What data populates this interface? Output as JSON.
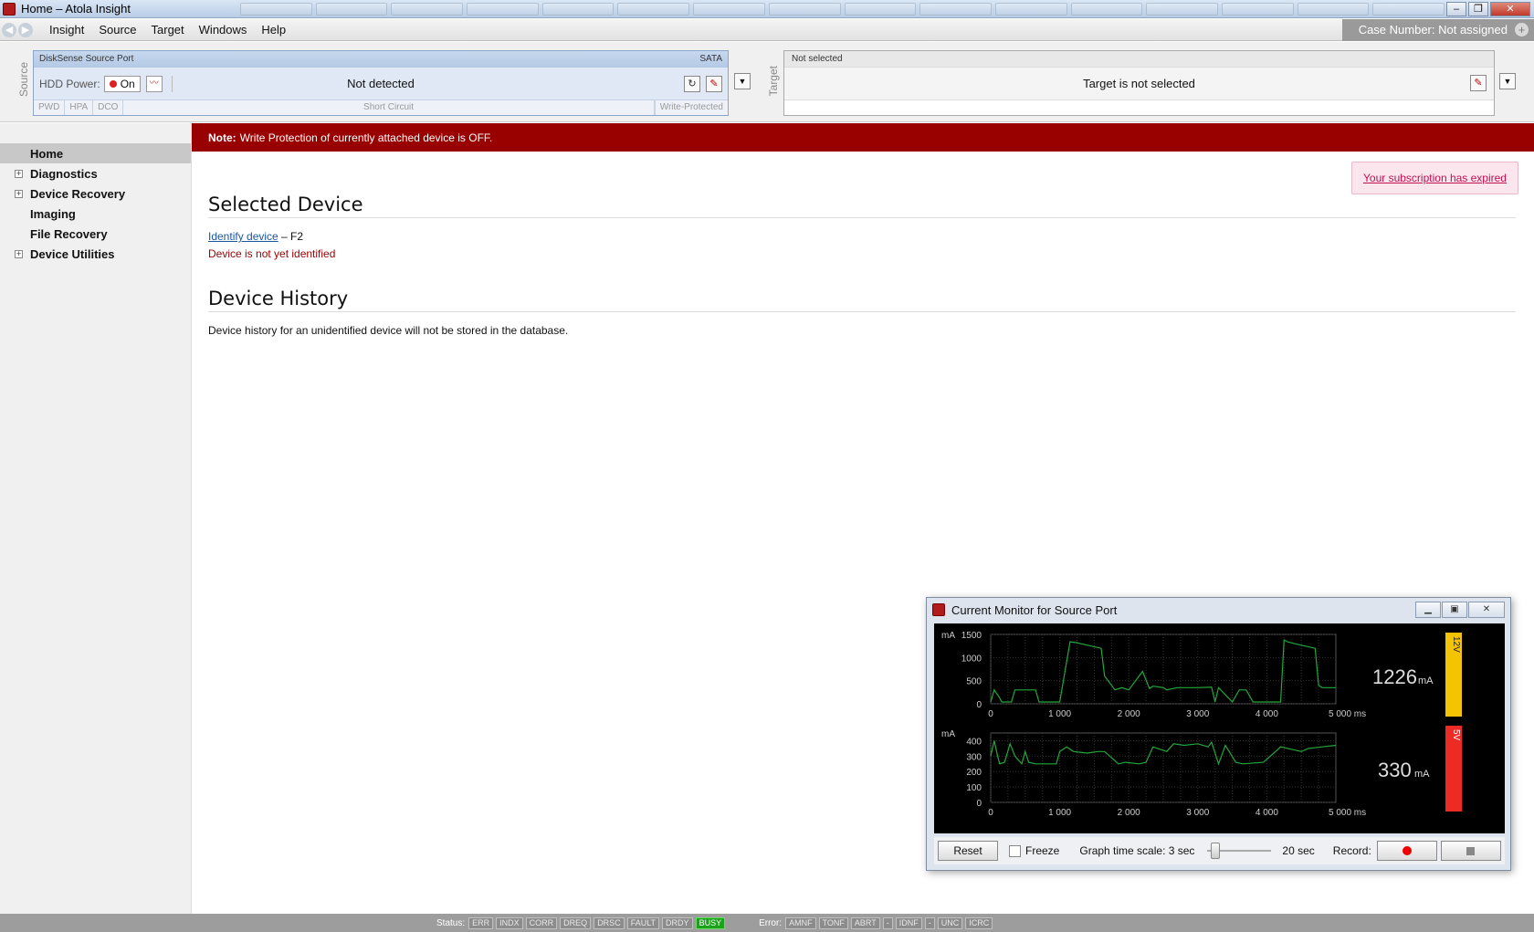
{
  "window": {
    "title": "Home – Atola Insight"
  },
  "menu": {
    "items": [
      "Insight",
      "Source",
      "Target",
      "Windows",
      "Help"
    ],
    "case_number": "Case Number: Not assigned"
  },
  "source": {
    "side_label": "Source",
    "port_name": "DiskSense Source Port",
    "interface": "SATA",
    "hdd_power_label": "HDD Power:",
    "power_state": "On",
    "status": "Not detected",
    "footer_flags": [
      "PWD",
      "HPA",
      "DCO"
    ],
    "short_circuit": "Short Circuit",
    "write_protected": "Write-Protected"
  },
  "target": {
    "side_label": "Target",
    "header": "Not selected",
    "status": "Target is not selected"
  },
  "sidebar": {
    "items": [
      {
        "label": "Home",
        "expandable": false,
        "active": true
      },
      {
        "label": "Diagnostics",
        "expandable": true,
        "active": false
      },
      {
        "label": "Device Recovery",
        "expandable": true,
        "active": false
      },
      {
        "label": "Imaging",
        "expandable": false,
        "active": false
      },
      {
        "label": "File Recovery",
        "expandable": false,
        "active": false
      },
      {
        "label": "Device Utilities",
        "expandable": true,
        "active": false
      }
    ]
  },
  "main": {
    "note_bold": "Note:",
    "note_text": "Write Protection of currently attached device is OFF.",
    "subscription": "Your subscription has expired",
    "selected_device_heading": "Selected Device",
    "identify_link": "Identify device",
    "identify_hotkey": " – F2",
    "not_identified": "Device is not yet identified",
    "history_heading": "Device History",
    "history_text": "Device history for an unidentified device will not be stored in the database."
  },
  "current_monitor": {
    "title": "Current Monitor for Source Port",
    "reset_label": "Reset",
    "freeze_label": "Freeze",
    "time_scale_label": "Graph time scale: 3 sec",
    "time_scale_max": "20 sec",
    "record_label": "Record:",
    "unit": "mA",
    "x_unit_label": "5 000 ms",
    "readout_12v": "1226",
    "readout_5v": "330",
    "rail_12v": "12V",
    "rail_5v": "5V",
    "color_12v": "#f5c400",
    "color_5v": "#ee2a24"
  },
  "chart_data": [
    {
      "type": "line",
      "title": "12V",
      "ylabel": "mA",
      "xlabel": "ms",
      "xlim": [
        0,
        5000
      ],
      "ylim": [
        0,
        1500
      ],
      "xticks": [
        "0",
        "1 000",
        "2 000",
        "3 000",
        "4 000",
        "5 000 ms"
      ],
      "yticks": [
        "1500",
        "1000",
        "500",
        "0"
      ],
      "series": [
        {
          "x": [
            0,
            50,
            120,
            160,
            300,
            350,
            650,
            700,
            950,
            1000,
            1150,
            1250,
            1300,
            1600,
            1650,
            1750,
            1800,
            1900,
            2000,
            2200,
            2300,
            2350,
            2500,
            2550,
            2700,
            2900,
            3000,
            3200,
            3250,
            3300,
            3500,
            3600,
            3700,
            3800,
            3850,
            3950,
            4200,
            4250,
            4300,
            4400,
            4700,
            4750,
            4800,
            5000
          ],
          "y": [
            40,
            300,
            150,
            40,
            40,
            300,
            300,
            40,
            40,
            40,
            1340,
            1320,
            1300,
            1200,
            600,
            400,
            300,
            350,
            300,
            700,
            330,
            380,
            350,
            300,
            350,
            350,
            350,
            360,
            40,
            350,
            40,
            300,
            300,
            40,
            40,
            40,
            40,
            1380,
            1340,
            1300,
            1200,
            400,
            350,
            350
          ],
          "color": "#22a83a"
        }
      ]
    },
    {
      "type": "line",
      "title": "5V",
      "ylabel": "mA",
      "xlabel": "ms",
      "xlim": [
        0,
        5000
      ],
      "ylim": [
        0,
        450
      ],
      "xticks": [
        "0",
        "1 000",
        "2 000",
        "3 000",
        "4 000",
        "5 000 ms"
      ],
      "yticks": [
        "400",
        "300",
        "200",
        "100",
        "0"
      ],
      "series": [
        {
          "x": [
            0,
            50,
            100,
            130,
            200,
            280,
            350,
            450,
            500,
            550,
            650,
            950,
            1000,
            1100,
            1200,
            1400,
            1550,
            1650,
            1850,
            1950,
            2150,
            2250,
            2350,
            2550,
            2650,
            2800,
            3000,
            3150,
            3200,
            3300,
            3400,
            3550,
            3650,
            3950,
            4100,
            4200,
            4500,
            4600,
            4800,
            5000
          ],
          "y": [
            300,
            400,
            300,
            250,
            260,
            380,
            300,
            250,
            330,
            260,
            250,
            250,
            330,
            360,
            330,
            320,
            330,
            330,
            250,
            260,
            250,
            260,
            360,
            330,
            380,
            370,
            380,
            360,
            390,
            250,
            370,
            260,
            250,
            260,
            320,
            360,
            330,
            350,
            360,
            370
          ],
          "color": "#22a83a"
        }
      ]
    }
  ],
  "statusbar": {
    "status_label": "Status:",
    "status_flags": [
      "ERR",
      "INDX",
      "CORR",
      "DREQ",
      "DRSC",
      "FAULT",
      "DRDY",
      "BUSY"
    ],
    "active_flag": "BUSY",
    "error_label": "Error:",
    "error_flags": [
      "AMNF",
      "TONF",
      "ABRT",
      "-",
      "IDNF",
      "-",
      "UNC",
      "ICRC"
    ]
  },
  "icons": {
    "back": "back-arrow-icon",
    "forward": "forward-arrow-icon",
    "refresh": "refresh-icon",
    "write_protect": "write-protect-icon",
    "power_wave": "power-wave-icon"
  }
}
